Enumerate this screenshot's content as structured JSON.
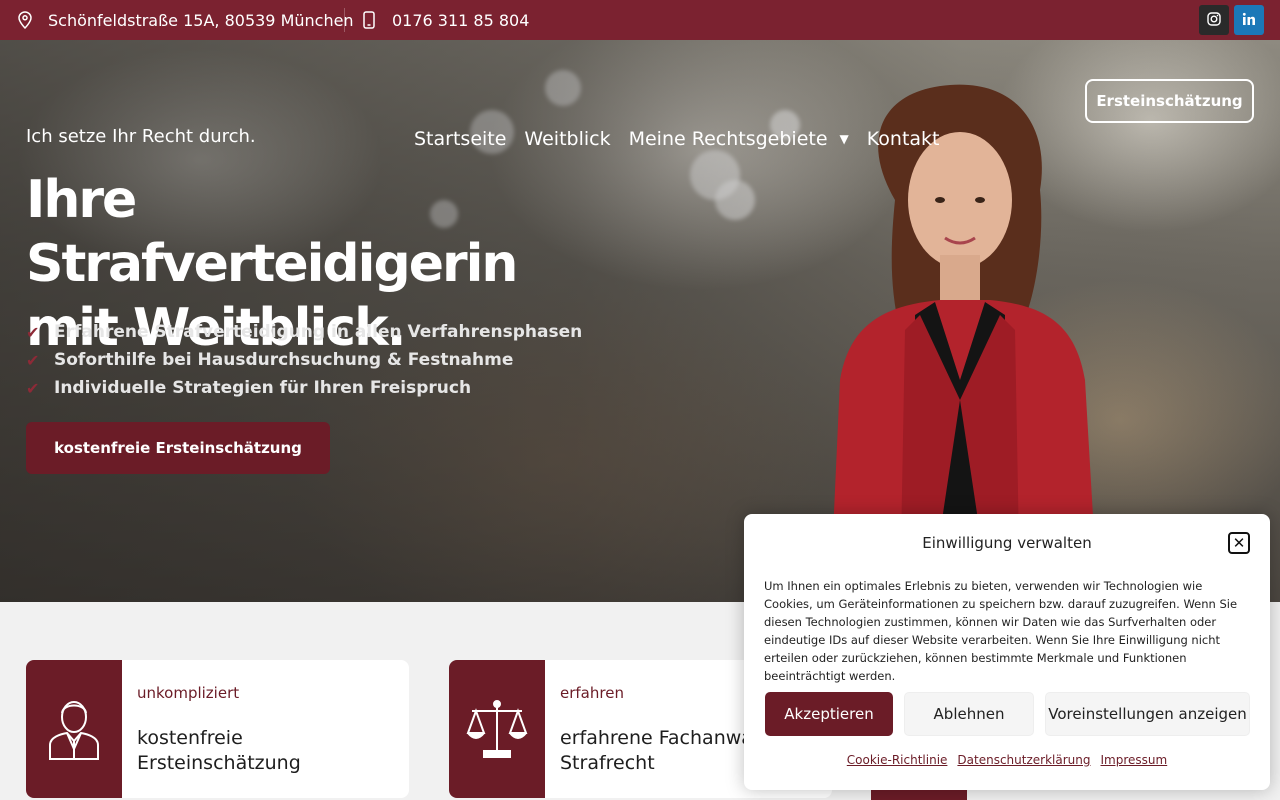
{
  "topbar": {
    "address": "Schönfeldstraße 15A, 80539 München",
    "phone": "0176 311 85 804",
    "icons": {
      "address": "map-pin-icon",
      "phone": "mobile-phone-icon",
      "instagram": "instagram-icon",
      "linkedin": "linkedin-icon"
    }
  },
  "nav": {
    "items": [
      {
        "label": "Startseite"
      },
      {
        "label": "Weitblick"
      },
      {
        "label": "Meine Rechtsgebiete"
      },
      {
        "label": "Kontakt"
      }
    ],
    "header_button": "Ersteinschätzung"
  },
  "hero": {
    "tagline": "Ich setze Ihr Recht durch.",
    "headline_line1": "Ihre Strafverteidigerin",
    "headline_line2": "mit Weitblick.",
    "bullets": [
      "Erfahrene Strafverteidigung in allen Verfahrensphasen",
      "Soforthilfe bei Hausdurchsuchung & Festnahme",
      "Individuelle Strategien für Ihren Freispruch"
    ],
    "cta": "kostenfreie Ersteinschätzung"
  },
  "cards": [
    {
      "kicker": "unkompliziert",
      "title_line1": "kostenfreie",
      "title_line2": "Ersteinschätzung",
      "icon": "lawyer-person-icon"
    },
    {
      "kicker": "erfahren",
      "title_line1": "erfahrene Fachanwä",
      "title_line2": "Strafrecht",
      "icon": "scales-of-justice-icon"
    }
  ],
  "cookie": {
    "title": "Einwilligung verwalten",
    "text": "Um Ihnen ein optimales Erlebnis zu bieten, verwenden wir Technologien wie Cookies, um Geräteinformationen zu speichern bzw. darauf zuzugreifen. Wenn Sie diesen Technologien zustimmen, können wir Daten wie das Surfverhalten oder eindeutige IDs auf dieser Website verarbeiten. Wenn Sie Ihre Einwilligung nicht erteilen oder zurückziehen, können bestimmte Merkmale und Funktionen beeinträchtigt werden.",
    "accept": "Akzeptieren",
    "deny": "Ablehnen",
    "preferences": "Voreinstellungen anzeigen",
    "links": [
      "Cookie-Richtlinie",
      "Datenschutzerklärung",
      "Impressum"
    ]
  },
  "colors": {
    "brand": "#7b2230",
    "brand_dark": "#6b1c27",
    "check": "#8d2a37",
    "linkedin": "#1b78b8"
  }
}
